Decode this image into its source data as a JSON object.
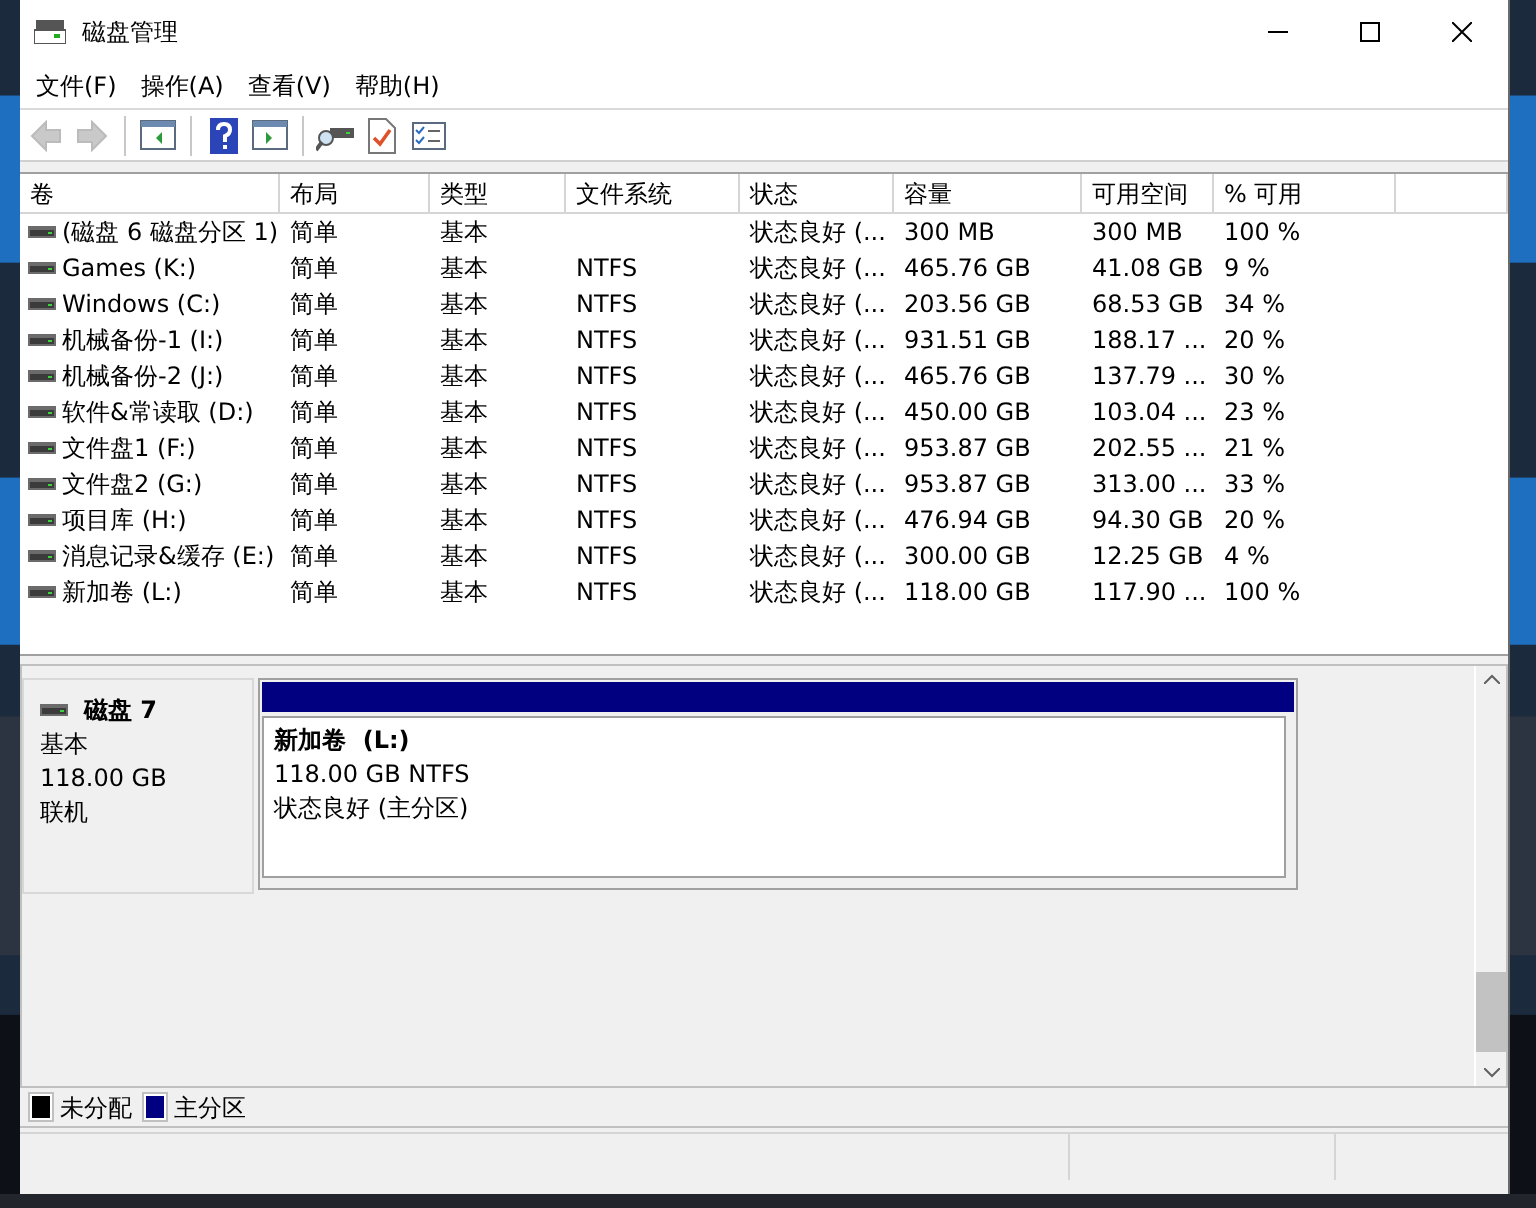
{
  "window": {
    "title": "磁盘管理"
  },
  "menu": [
    "文件(F)",
    "操作(A)",
    "查看(V)",
    "帮助(H)"
  ],
  "toolbar": [
    {
      "kind": "back",
      "disabled": true
    },
    {
      "kind": "forward",
      "disabled": true
    },
    {
      "kind": "sep"
    },
    {
      "kind": "panel-left",
      "disabled": false
    },
    {
      "kind": "sep"
    },
    {
      "kind": "help",
      "disabled": false
    },
    {
      "kind": "panel-right",
      "disabled": false
    },
    {
      "kind": "sep"
    },
    {
      "kind": "connect",
      "disabled": false
    },
    {
      "kind": "check-doc",
      "disabled": false
    },
    {
      "kind": "checklist",
      "disabled": false
    }
  ],
  "table": {
    "columns": [
      "卷",
      "布局",
      "类型",
      "文件系统",
      "状态",
      "容量",
      "可用空间",
      "% 可用"
    ],
    "rows": [
      [
        "(磁盘 6 磁盘分区 1)",
        "简单",
        "基本",
        "",
        "状态良好 (...",
        "300 MB",
        "300 MB",
        "100 %"
      ],
      [
        "Games (K:)",
        "简单",
        "基本",
        "NTFS",
        "状态良好 (...",
        "465.76 GB",
        "41.08 GB",
        "9 %"
      ],
      [
        "Windows (C:)",
        "简单",
        "基本",
        "NTFS",
        "状态良好 (...",
        "203.56 GB",
        "68.53 GB",
        "34 %"
      ],
      [
        "机械备份-1 (I:)",
        "简单",
        "基本",
        "NTFS",
        "状态良好 (...",
        "931.51 GB",
        "188.17 ...",
        "20 %"
      ],
      [
        "机械备份-2 (J:)",
        "简单",
        "基本",
        "NTFS",
        "状态良好 (...",
        "465.76 GB",
        "137.79 ...",
        "30 %"
      ],
      [
        "软件&常读取 (D:)",
        "简单",
        "基本",
        "NTFS",
        "状态良好 (...",
        "450.00 GB",
        "103.04 ...",
        "23 %"
      ],
      [
        "文件盘1 (F:)",
        "简单",
        "基本",
        "NTFS",
        "状态良好 (...",
        "953.87 GB",
        "202.55 ...",
        "21 %"
      ],
      [
        "文件盘2 (G:)",
        "简单",
        "基本",
        "NTFS",
        "状态良好 (...",
        "953.87 GB",
        "313.00 ...",
        "33 %"
      ],
      [
        "项目库 (H:)",
        "简单",
        "基本",
        "NTFS",
        "状态良好 (...",
        "476.94 GB",
        "94.30 GB",
        "20 %"
      ],
      [
        "消息记录&缓存 (E:)",
        "简单",
        "基本",
        "NTFS",
        "状态良好 (...",
        "300.00 GB",
        "12.25 GB",
        "4 %"
      ],
      [
        "新加卷 (L:)",
        "简单",
        "基本",
        "NTFS",
        "状态良好 (...",
        "118.00 GB",
        "117.90 ...",
        "100 %"
      ]
    ]
  },
  "disk": {
    "name": "磁盘 7",
    "type": "基本",
    "size": "118.00 GB",
    "status": "联机",
    "partition": {
      "name": "新加卷  (L:)",
      "size": "118.00 GB NTFS",
      "status": "状态良好 (主分区)",
      "color": "#000080"
    }
  },
  "legend": [
    {
      "label": "未分配",
      "color": "#000000"
    },
    {
      "label": "主分区",
      "color": "#000080"
    }
  ]
}
